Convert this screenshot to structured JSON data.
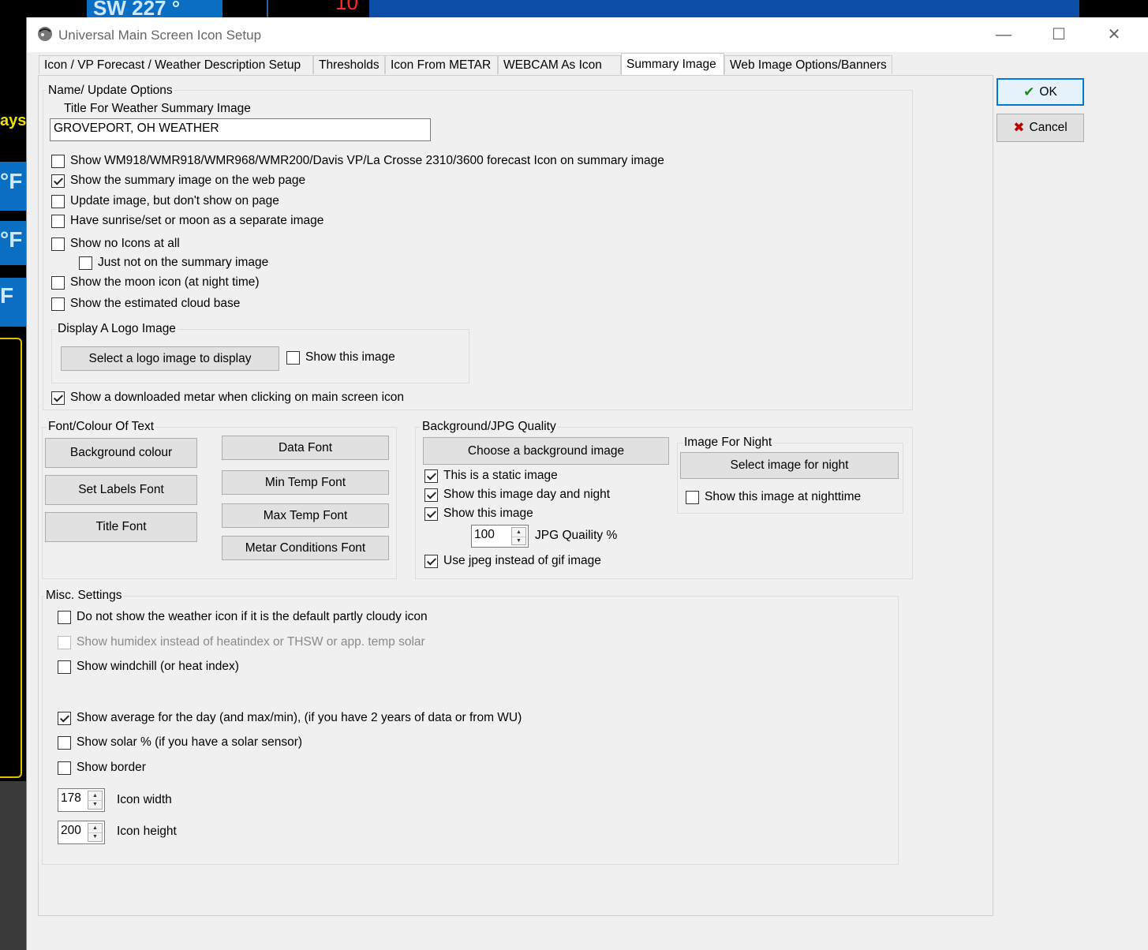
{
  "background_app": {
    "wind_text": "SW 227 °",
    "num_top": "10",
    "days_text": "ays",
    "temp1": "°F",
    "temp2": "°F",
    "temp3": "F"
  },
  "window": {
    "title": "Universal Main Screen Icon Setup",
    "minimize": "—",
    "maximize": "☐",
    "close": "✕"
  },
  "tabs": [
    {
      "label": "Icon / VP Forecast / Weather Description Setup"
    },
    {
      "label": "Thresholds"
    },
    {
      "label": "Icon From METAR"
    },
    {
      "label": "WEBCAM As Icon"
    },
    {
      "label": "Summary Image"
    },
    {
      "label": "Web Image Options/Banners"
    }
  ],
  "buttons": {
    "ok": "OK",
    "cancel": "Cancel"
  },
  "name_group": {
    "label": "Name/ Update Options",
    "title_label": "Title For Weather Summary Image",
    "title_value": "GROVEPORT, OH  WEATHER",
    "checkboxes": [
      {
        "label": "Show WM918/WMR918/WMR968/WMR200/Davis VP/La Crosse 2310/3600 forecast Icon on summary image",
        "checked": false
      },
      {
        "label": "Show the summary image on the web page",
        "checked": true
      },
      {
        "label": "Update image, but don't show on page",
        "checked": false
      },
      {
        "label": "Have sunrise/set or moon as a separate image",
        "checked": false
      },
      {
        "label": "Show no Icons at all",
        "checked": false
      },
      {
        "label": "Just not on the summary image",
        "checked": false
      },
      {
        "label": "Show the moon icon (at night time)",
        "checked": false
      },
      {
        "label": "Show the estimated cloud base",
        "checked": false
      }
    ],
    "logo": {
      "label": "Display A Logo Image",
      "select_button": "Select a logo image to display",
      "show_label": "Show this image",
      "show_checked": false
    },
    "metar": {
      "label": "Show a downloaded metar when clicking on main screen icon",
      "checked": true
    }
  },
  "font_group": {
    "label": "Font/Colour Of Text",
    "buttons_left": [
      "Background colour",
      "Set Labels Font",
      "Title Font"
    ],
    "buttons_right": [
      "Data Font",
      "Min Temp Font",
      "Max Temp Font",
      "Metar Conditions Font"
    ]
  },
  "bg_group": {
    "label": "Background/JPG Quality",
    "choose_button": "Choose a background image",
    "checkboxes": [
      {
        "label": "This is a static image",
        "checked": true
      },
      {
        "label": "Show this image day and night",
        "checked": true
      },
      {
        "label": "Show this image",
        "checked": true
      }
    ],
    "jpg_value": "100",
    "jpg_label": "JPG Quaility %",
    "jpeg_cb": {
      "label": "Use jpeg instead of gif image",
      "checked": true
    },
    "night": {
      "label": "Image For Night",
      "select_button": "Select image for night",
      "show_label": "Show this image at nighttime",
      "show_checked": false
    }
  },
  "misc_group": {
    "label": "Misc. Settings",
    "checkboxes": [
      {
        "label": "Do not show the weather icon if it is the default partly cloudy icon",
        "checked": false,
        "disabled": false
      },
      {
        "label": "Show humidex instead of heatindex or THSW or app. temp solar",
        "checked": false,
        "disabled": true
      },
      {
        "label": "Show windchill (or heat index)",
        "checked": false,
        "disabled": false
      },
      {
        "label": "Show average for the day (and max/min), (if you have 2 years of data or from WU)",
        "checked": true,
        "disabled": false
      },
      {
        "label": "Show solar % (if you have a solar sensor)",
        "checked": false,
        "disabled": false
      },
      {
        "label": "Show border",
        "checked": false,
        "disabled": false
      }
    ],
    "icon_width_value": "178",
    "icon_width_label": "Icon width",
    "icon_height_value": "200",
    "icon_height_label": "Icon height"
  }
}
